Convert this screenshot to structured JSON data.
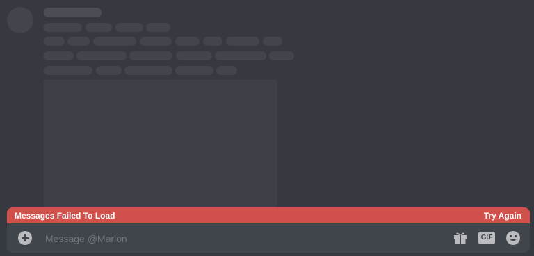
{
  "error_banner": {
    "message": "Messages Failed To Load",
    "retry_label": "Try Again"
  },
  "composer": {
    "placeholder": "Message @Marlon",
    "value": "",
    "gif_label": "GIF"
  },
  "icons": {
    "attach": "plus-circle-icon",
    "gift": "gift-icon",
    "gif": "gif-icon",
    "emoji": "emoji-smile-icon"
  },
  "colors": {
    "background": "#36393f",
    "skeleton": "#42454b",
    "error_banner": "#d0514b",
    "composer": "#40444b",
    "icon": "#b9bbbe",
    "placeholder": "#72767d"
  }
}
